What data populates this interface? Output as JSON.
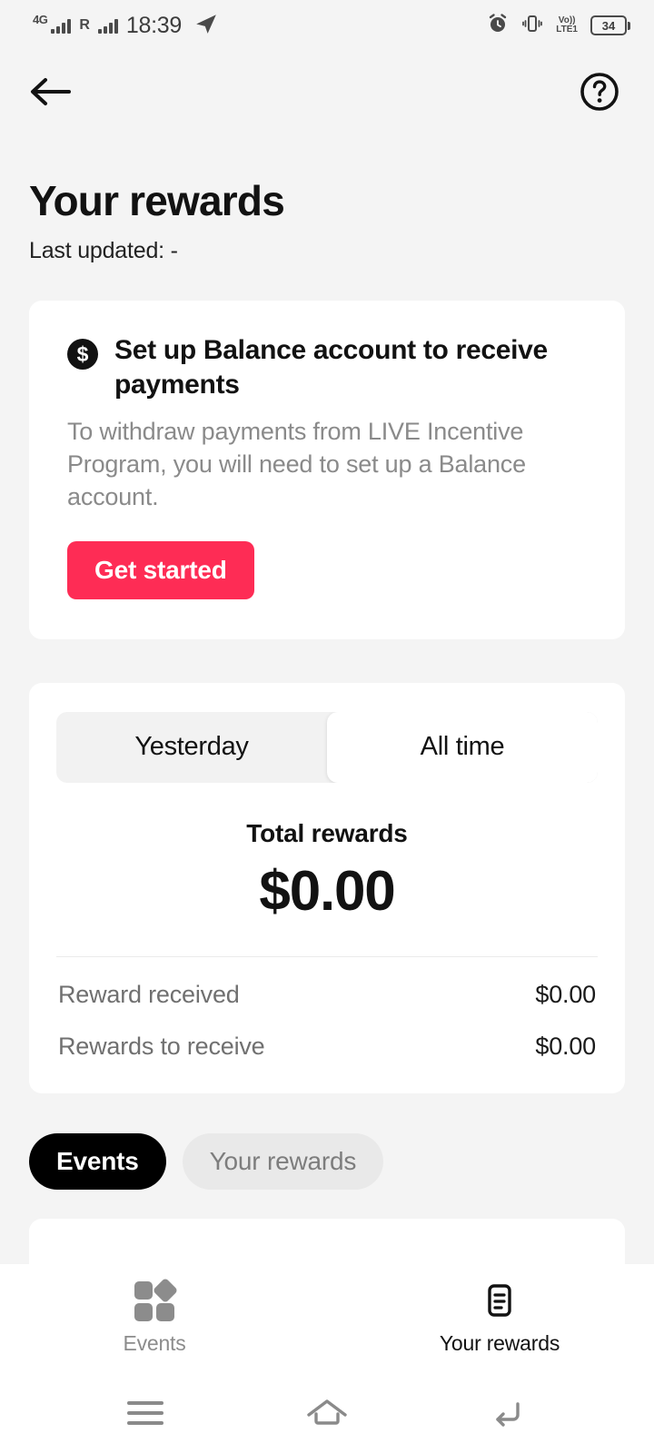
{
  "status_bar": {
    "network_type": "4G",
    "roaming": "R",
    "time": "18:39",
    "volte_top": "Vo))",
    "volte_bottom": "LTE1",
    "battery_level": "34",
    "icons": [
      "signal-bars",
      "roaming",
      "telegram-send",
      "alarm",
      "vibrate",
      "volte",
      "battery"
    ]
  },
  "top_bar": {
    "back_label": "Back",
    "help_label": "Help"
  },
  "header": {
    "title": "Your rewards",
    "last_updated": "Last updated: -"
  },
  "balance_card": {
    "icon": "dollar-coin-icon",
    "icon_glyph": "$",
    "title": "Set up Balance account to receive payments",
    "description": "To withdraw payments from LIVE Incentive Program, you will need to set up a Balance account.",
    "button_label": "Get started",
    "button_color": "#fe2c55"
  },
  "rewards_card": {
    "segments": [
      {
        "label": "Yesterday",
        "active": false
      },
      {
        "label": "All time",
        "active": true
      }
    ],
    "total_label": "Total rewards",
    "total_amount": "$0.00",
    "stats": [
      {
        "label": "Reward received",
        "value": "$0.00"
      },
      {
        "label": "Rewards to receive",
        "value": "$0.00"
      }
    ]
  },
  "chips": [
    {
      "label": "Events",
      "active": true
    },
    {
      "label": "Your rewards",
      "active": false
    }
  ],
  "bottom_nav": [
    {
      "label": "Events",
      "icon": "grid-diamond-icon",
      "active": false
    },
    {
      "label": "Your rewards",
      "icon": "document-lines-icon",
      "active": true
    }
  ],
  "android_nav": {
    "recents": "recents-menu-icon",
    "home": "home-icon",
    "back": "back-arrow-icon"
  },
  "colors": {
    "background": "#f4f4f4",
    "card": "#ffffff",
    "accent": "#fe2c55",
    "active_chip": "#000000",
    "muted_text": "#8a8a8a"
  }
}
